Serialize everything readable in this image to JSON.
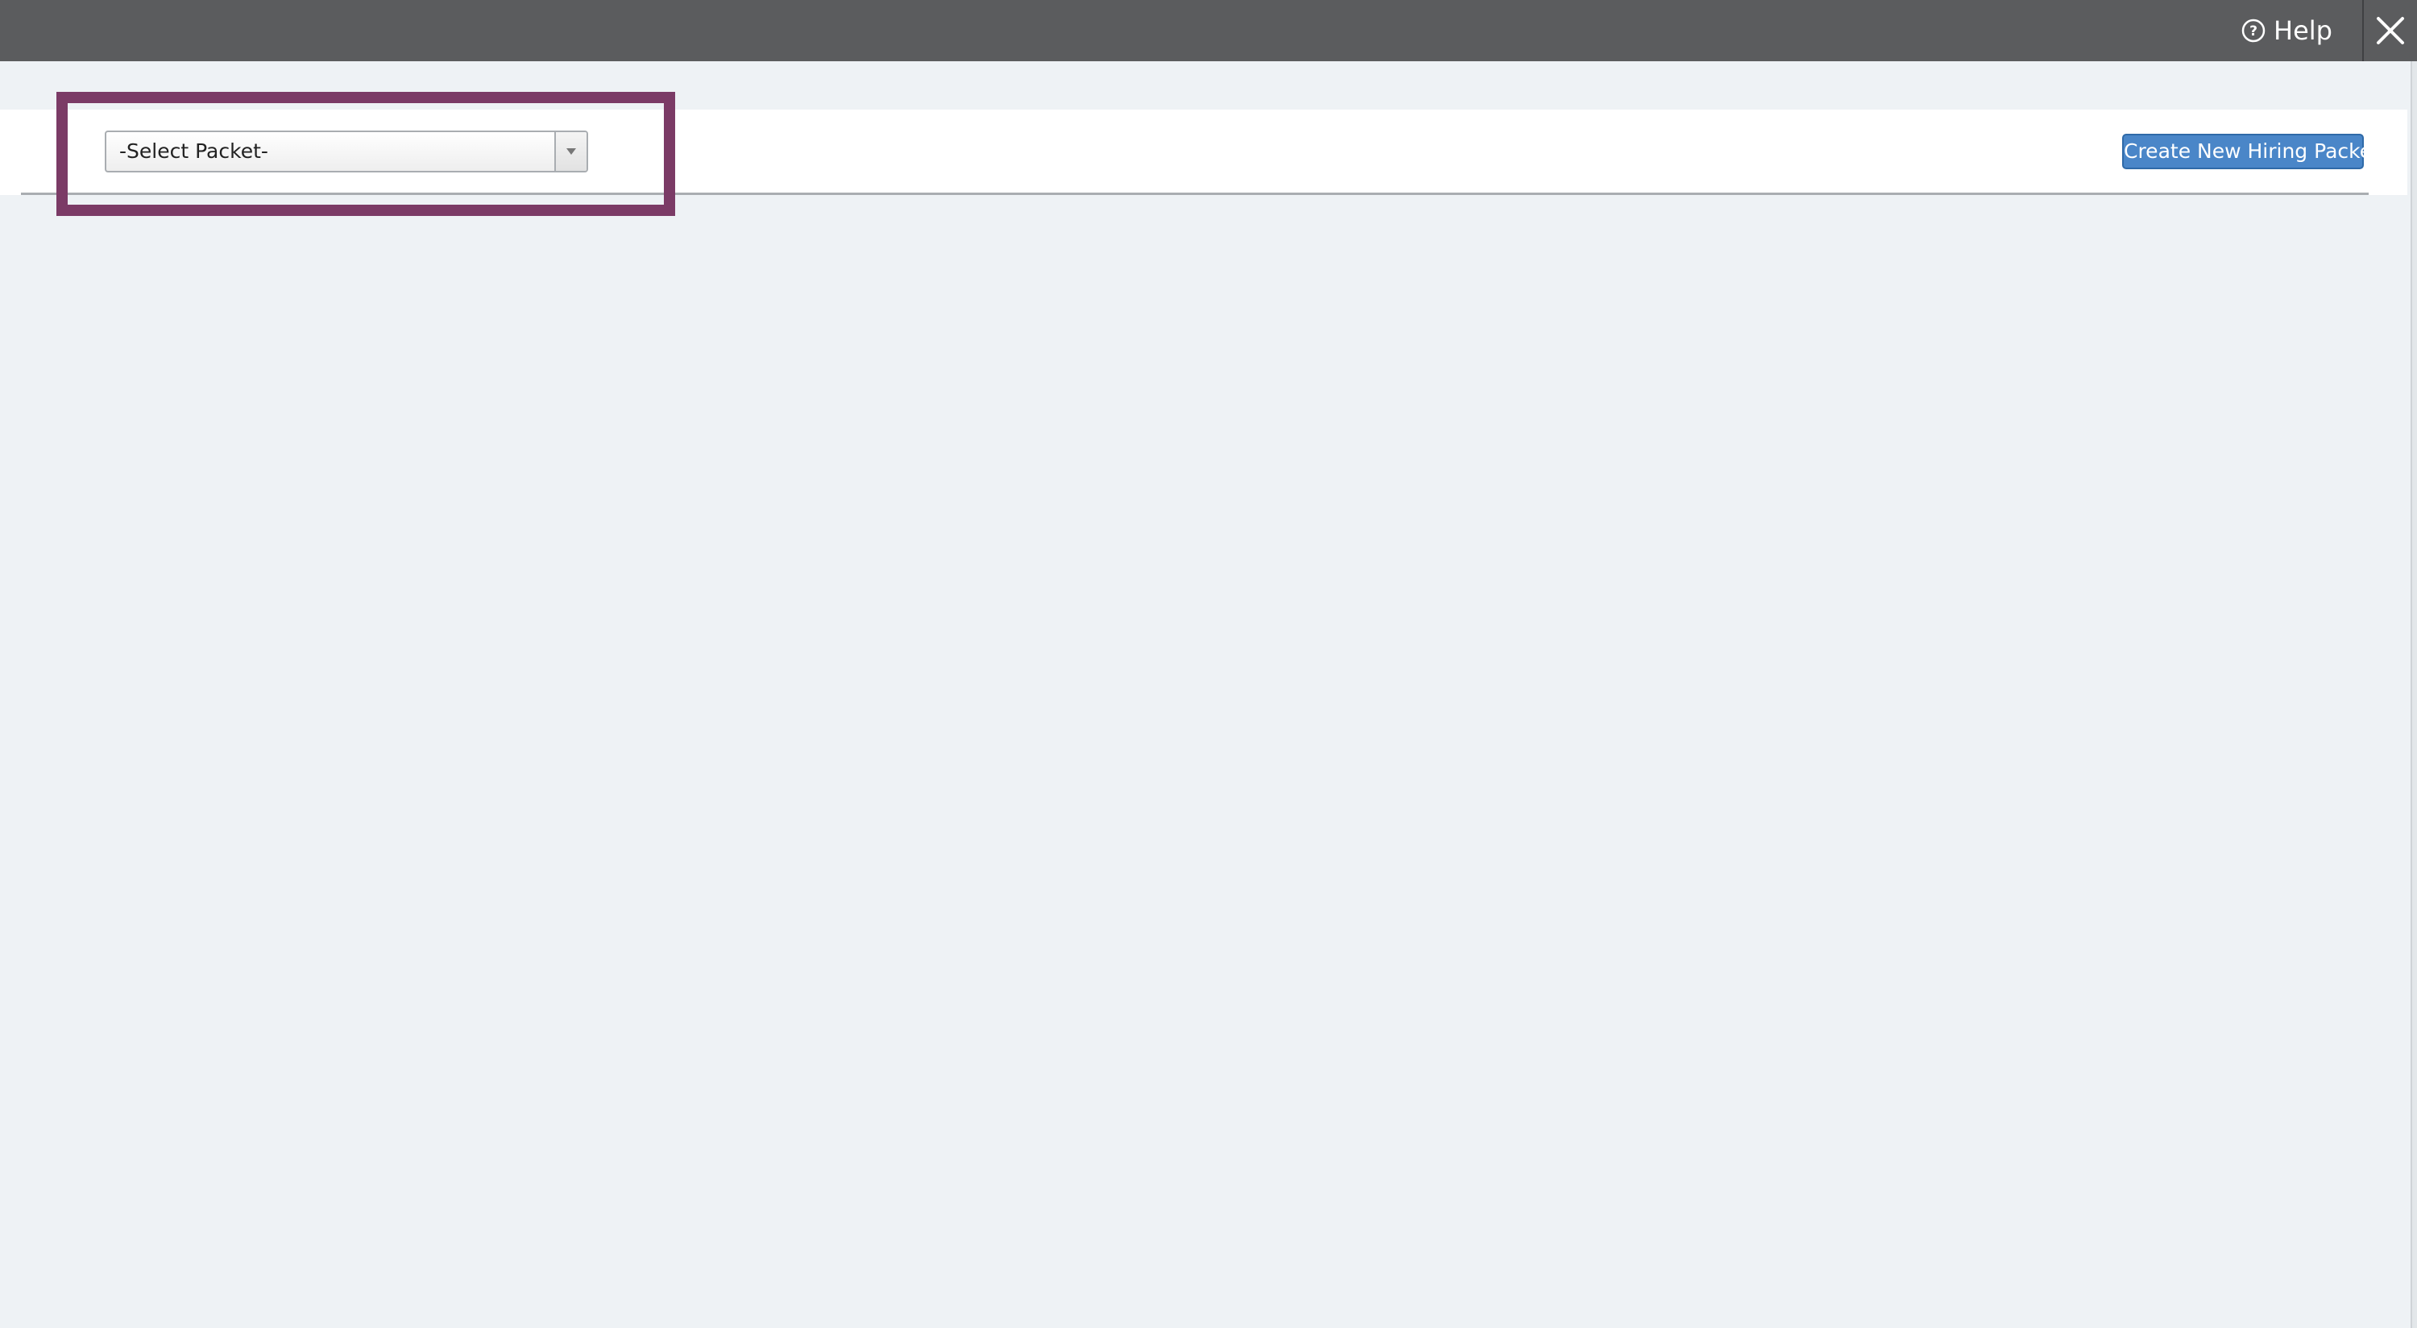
{
  "topbar": {
    "help_label": "Help",
    "help_icon": "question-circle-icon",
    "close_icon": "close-x-icon"
  },
  "toolbar": {
    "packet_select": {
      "selected_value": "-Select Packet-",
      "arrow_icon": "chevron-down-icon"
    },
    "create_button_label": "Create New Hiring Packet"
  },
  "colors": {
    "topbar_bg": "#5b5c5e",
    "page_bg": "#eef2f5",
    "highlight_border": "#7b3b66",
    "primary_button": "#4a86c8"
  }
}
